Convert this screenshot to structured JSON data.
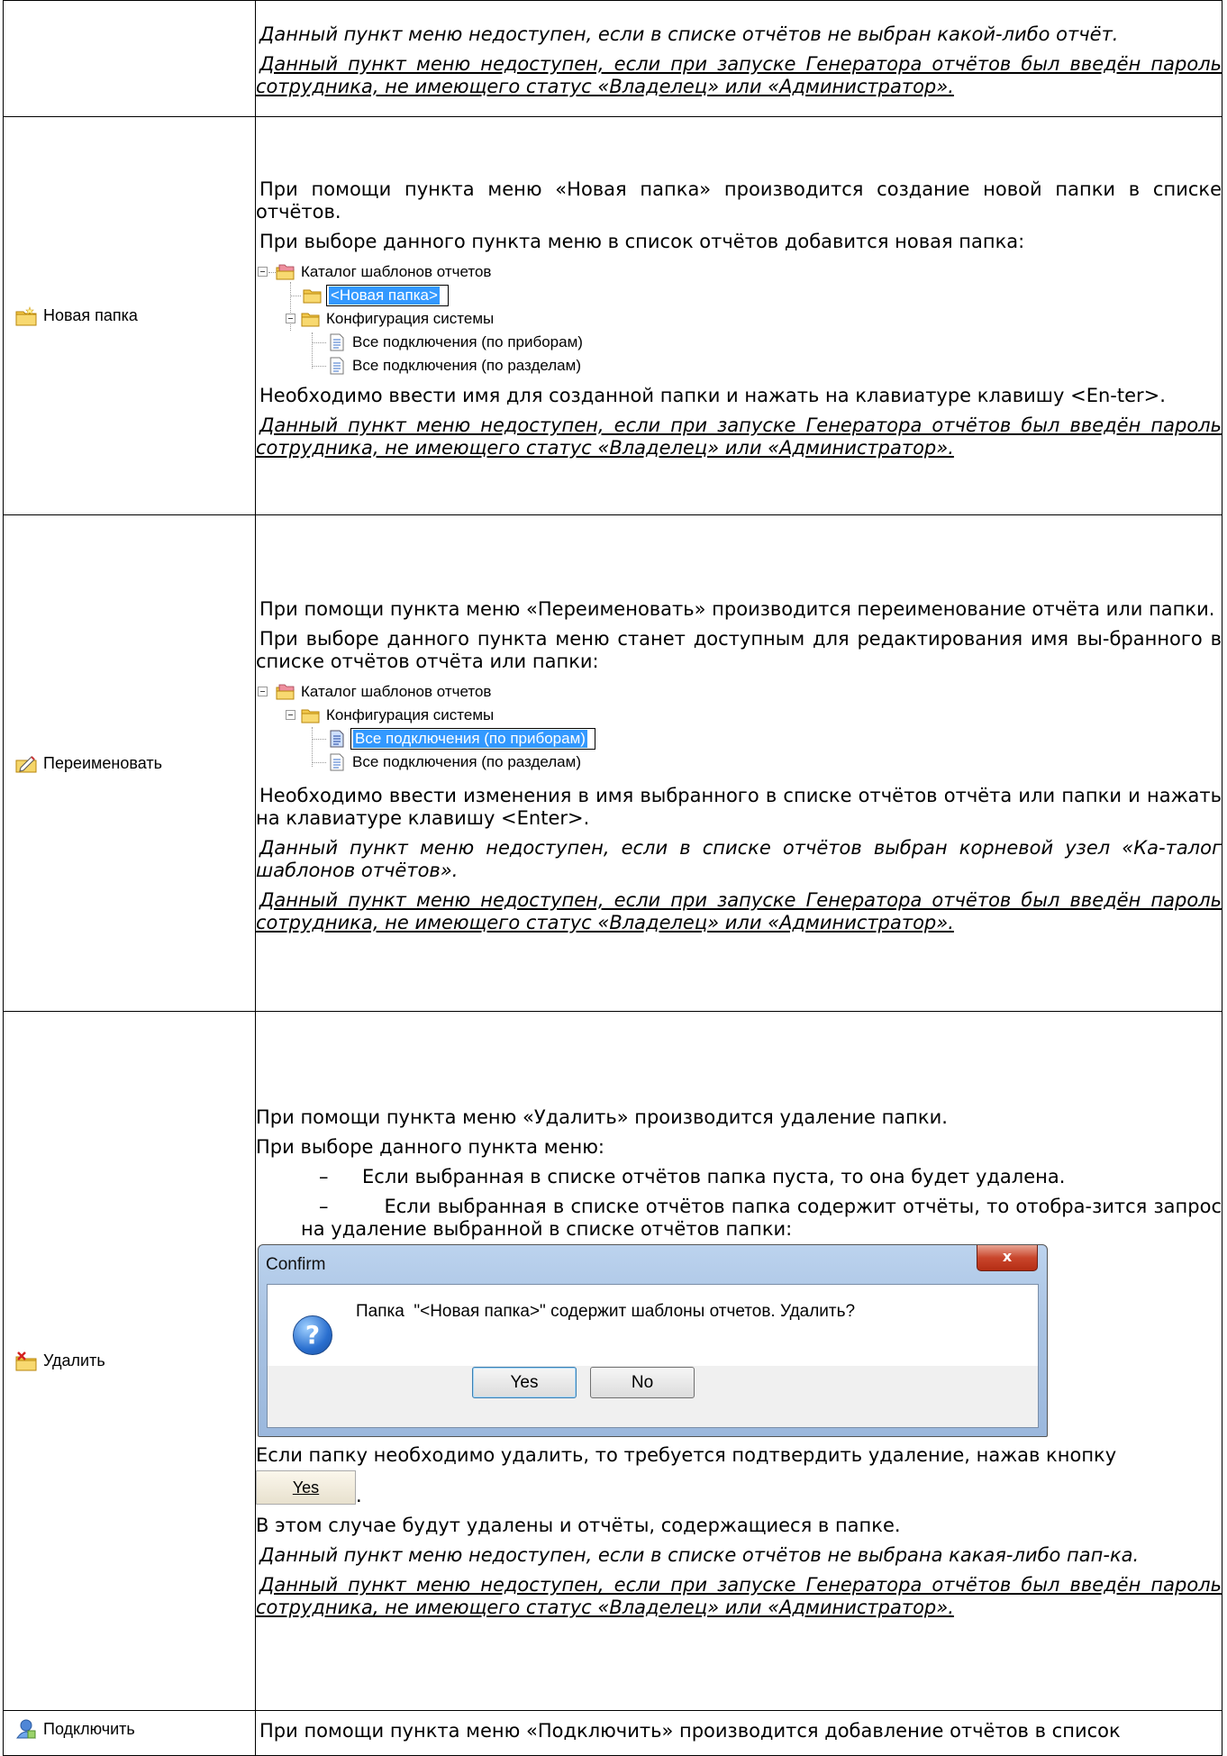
{
  "row0": {
    "note1": "Данный пункт меню недоступен, если в списке отчётов не выбран какой-либо отчёт.",
    "note2": "Данный пункт меню недоступен, если при запуске Генератора отчётов был введён пароль сотрудника, не имеющего статус «Владелец» или «Администратор»."
  },
  "new_folder": {
    "menu_label": "Новая папка",
    "icon": "new-folder-icon",
    "p1": "При помощи пункта меню «Новая папка» производится создание новой папки в списке отчётов.",
    "p2": "При выборе данного пункта меню в список отчётов добавится новая папка:",
    "tree": {
      "root": "Каталог шаблонов отчетов",
      "new_folder": "<Новая папка>",
      "config": "Конфигурация системы",
      "item1": "Все подключения (по приборам)",
      "item2": "Все подключения (по разделам)"
    },
    "p3": "Необходимо ввести имя для созданной папки и нажать на клавиатуре клавишу <En-ter>.",
    "note": "Данный пункт меню недоступен, если при запуске Генератора отчётов был введён пароль сотрудника, не имеющего статус «Владелец» или «Администратор»."
  },
  "rename": {
    "menu_label": "Переименовать",
    "icon": "rename-icon",
    "p1": "При помощи пункта меню «Переименовать» производится переименование отчёта или папки.",
    "p2": "При выборе данного пункта меню станет доступным для редактирования имя вы-бранного в списке отчётов отчёта или папки:",
    "tree": {
      "root": "Каталог шаблонов отчетов",
      "config": "Конфигурация системы",
      "item1": "Все подключения (по приборам)",
      "item2": "Все подключения (по разделам)"
    },
    "p3": "Необходимо ввести изменения в имя выбранного в списке отчётов отчёта или папки и нажать на клавиатуре клавишу <Enter>.",
    "note1": "Данный пункт меню недоступен, если в списке отчётов выбран корневой узел «Ка-талог шаблонов отчётов».",
    "note2": "Данный пункт меню недоступен, если при запуске Генератора отчётов был введён пароль сотрудника, не имеющего статус «Владелец» или «Администратор»."
  },
  "delete": {
    "menu_label": "Удалить",
    "icon": "delete-icon",
    "p1": "При помощи пункта меню «Удалить» производится удаление папки.",
    "p2": "При выборе данного пункта меню:",
    "bullet_dash": "–",
    "b1": "Если выбранная в списке отчётов папка пуста, то она будет удалена.",
    "b2": "Если выбранная в списке отчётов папка содержит отчёты, то отобра-зится запрос на удаление выбранной в списке отчётов папки:",
    "dialog": {
      "title": "Confirm",
      "close": "x",
      "message": "Папка  \"<Новая папка>\" содержит шаблоны отчетов. Удалить?",
      "yes": "Yes",
      "no": "No"
    },
    "p3": "Если папку необходимо удалить, то требуется подтвердить удаление, нажав кнопку",
    "yes_button": "Yes",
    "p3_end": ".",
    "p4": "В этом случае будут удалены и отчёты, содержащиеся в папке.",
    "note1": "Данный пункт меню недоступен, если в списке отчётов не выбрана какая-либо пап-ка.",
    "note2": "Данный пункт меню недоступен, если при запуске Генератора отчётов был введён пароль сотрудника, не имеющего статус «Владелец» или «Администратор»."
  },
  "connect": {
    "menu_label": "Подключить",
    "icon": "connect-icon",
    "p1": "При помощи пункта меню «Подключить» производится добавление отчётов в список"
  }
}
